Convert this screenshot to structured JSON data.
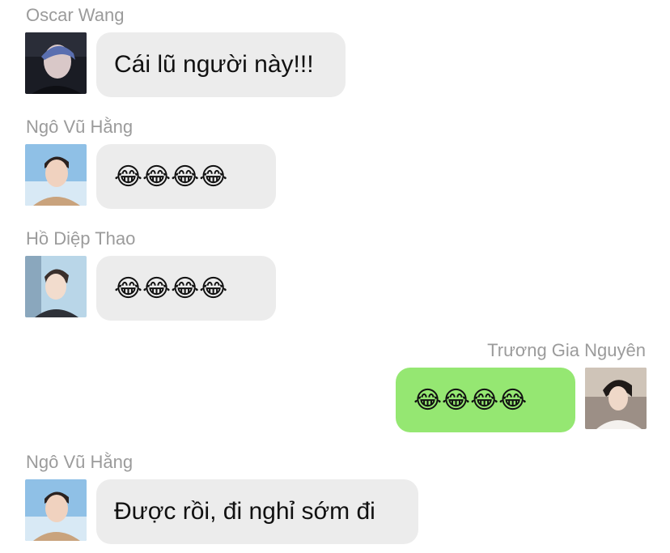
{
  "messages": [
    {
      "sender": "Oscar Wang",
      "text": "Cái lũ người này!!!",
      "avatar": "oscar-wang-avatar"
    },
    {
      "sender": "Ngô Vũ Hằng",
      "text": "😂😂😂😂",
      "avatar": "ngo-vu-hang-avatar"
    },
    {
      "sender": "Hồ Diệp Thao",
      "text": "😂😂😂😂",
      "avatar": "ho-diep-thao-avatar"
    },
    {
      "sender": "Trương Gia Nguyên",
      "text": "😂😂😂😂",
      "avatar": "truong-gia-nguyen-avatar"
    },
    {
      "sender": "Ngô Vũ Hằng",
      "text": "Được rồi, đi nghỉ sớm đi",
      "avatar": "ngo-vu-hang-avatar"
    }
  ],
  "colors": {
    "incoming_bubble": "#ececec",
    "outgoing_bubble": "#95e772",
    "sender_name": "#9b9b9b"
  }
}
